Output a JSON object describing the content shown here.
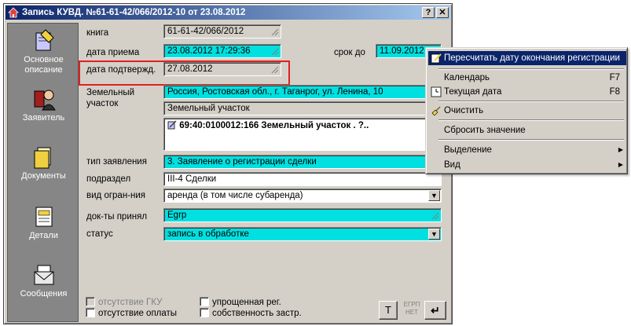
{
  "window": {
    "title": "Запись КУВД. №61-61-42/066/2012-10 от 23.08.2012",
    "help_label": "?",
    "close_label": "✕"
  },
  "sidebar": {
    "items": [
      {
        "label": "Основное описание",
        "icon": "pencil-book-icon"
      },
      {
        "label": "Заявитель",
        "icon": "person-icon"
      },
      {
        "label": "Документы",
        "icon": "folder-icon"
      },
      {
        "label": "Детали",
        "icon": "document-details-icon"
      },
      {
        "label": "Сообщения",
        "icon": "envelope-icon"
      }
    ]
  },
  "form": {
    "kniga_label": "книга",
    "kniga_value": "61-61-42/066/2012",
    "data_priema_label": "дата приема",
    "data_priema_value": "23.08.2012 17:29:36",
    "srok_do_label": "срок до",
    "srok_do_value": "11.09.2012",
    "data_podtverzhd_label": "дата подтвержд.",
    "data_podtverzhd_value": "27.08.2012",
    "zemelny_label_1": "Земельный",
    "zemelny_label_2": "участок",
    "zemelny_address": "Россия, Ростовская обл., г. Таганрог, ул. Ленина, 10",
    "zemelny_type": "Земельный участок",
    "zemelny_cadastral": "69:40:0100012:166 Земельный участок . ?..",
    "tip_zayavleniya_label": "тип заявления",
    "tip_zayavleniya_value": "3. Заявление о регистрации сделки",
    "podrazdel_label": "подраздел",
    "podrazdel_value": "III-4    Сделки",
    "vid_ogran_label": "вид огран-ния",
    "vid_ogran_value": "аренда (в том числе субаренда)",
    "dok_prinyal_label": "док-ты принял",
    "dok_prinyal_value": "Egrp",
    "status_label": "статус",
    "status_value": "запись в обработке"
  },
  "checkboxes": {
    "otsutstvie_gku": "отсутствие ГКУ",
    "otsutstvie_oplaty": "отсутствие оплаты",
    "uproshchennaya": "упрощенная рег.",
    "sobstvennost": "собственность застр."
  },
  "buttons": {
    "t_label": "T",
    "egrp_label": "ЕГРП",
    "net_label": "НЕТ",
    "enter_label": "↵"
  },
  "context_menu": {
    "items": [
      {
        "label": "Пересчитать дату окончания регистрации",
        "shortcut": "",
        "highlighted": true
      },
      {
        "label": "Календарь",
        "shortcut": "F7"
      },
      {
        "label": "Текущая дата",
        "shortcut": "F8"
      },
      {
        "label": "Очистить",
        "shortcut": ""
      },
      {
        "label": "Сбросить значение",
        "shortcut": ""
      },
      {
        "label": "Выделение",
        "shortcut": ""
      },
      {
        "label": "Вид",
        "shortcut": ""
      }
    ]
  },
  "colors": {
    "accent_cyan": "#00e0e0",
    "titlebar": "#0a246a",
    "highlight_red": "#e02020"
  }
}
